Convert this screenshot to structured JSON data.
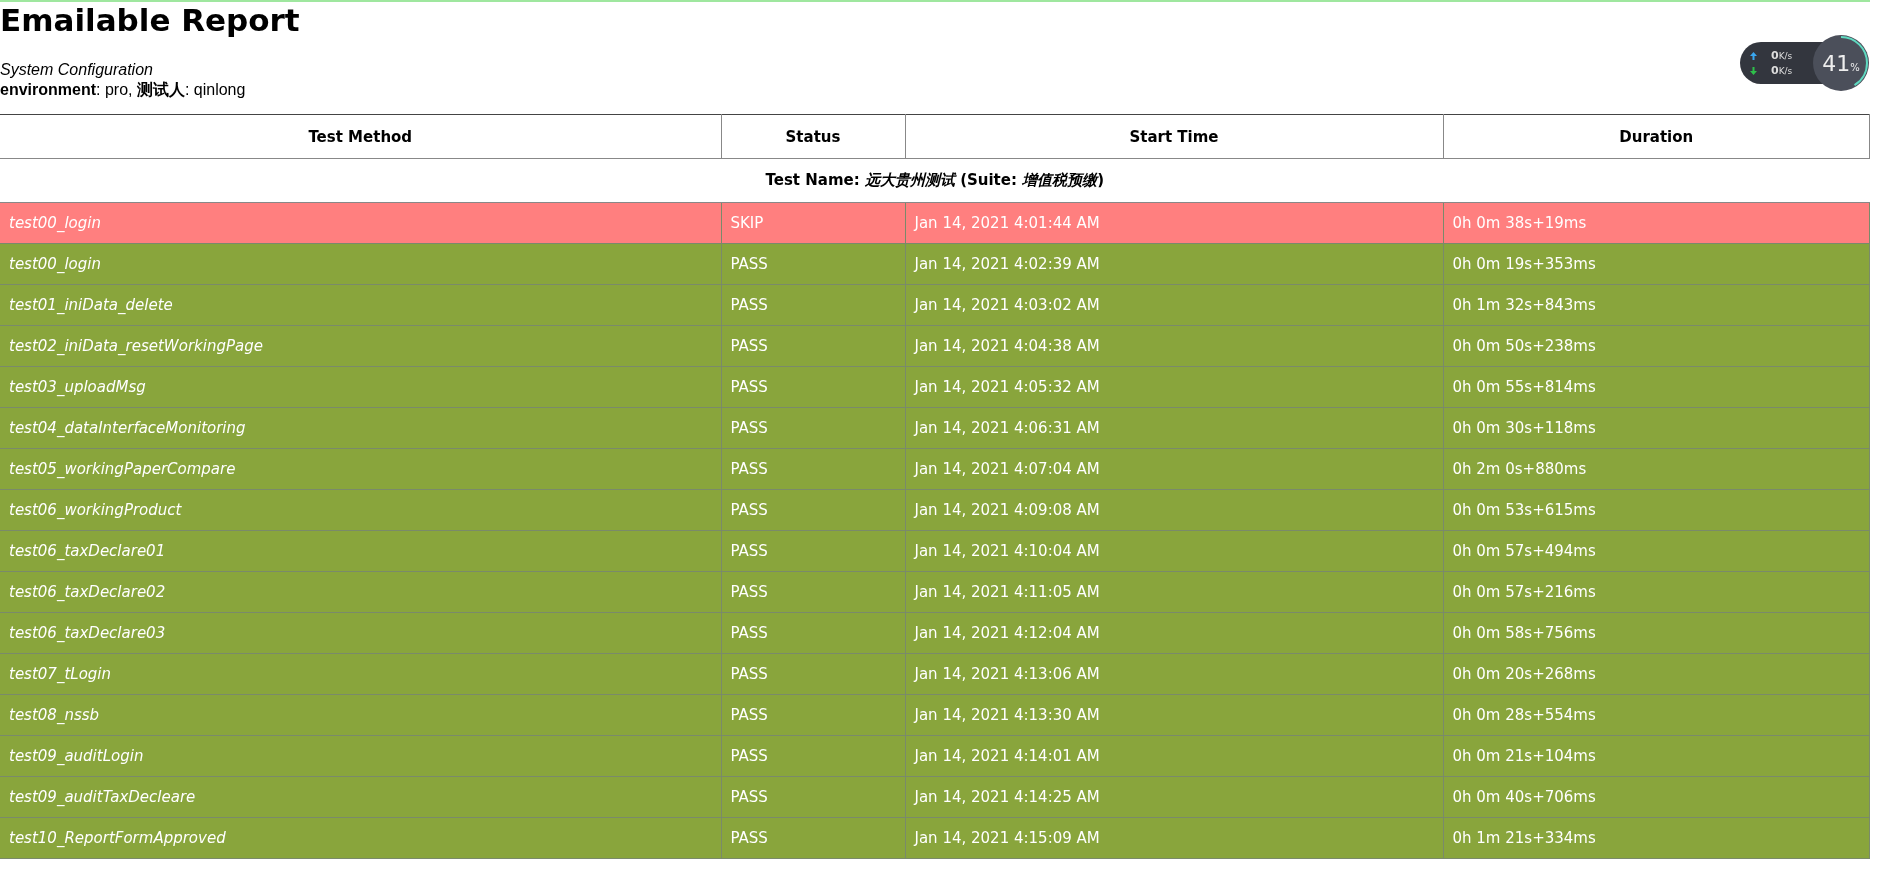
{
  "title": "Emailable Report",
  "config": {
    "heading": "System Configuration",
    "line": "**environment**: pro, **测试人**: qinlong"
  },
  "speed_widget": {
    "upload_value": "0",
    "upload_unit": "K/s",
    "download_value": "0",
    "download_unit": "K/s",
    "percent": "41",
    "percent_sign": "%",
    "level": 0.41
  },
  "table": {
    "columns": [
      "Test Method",
      "Status",
      "Start Time",
      "Duration"
    ],
    "group_title": "Test Name: *远大贵州测试* (Suite: *增值税预缴*)",
    "rows": [
      {
        "kind": "skip",
        "method": "test00_login",
        "status": "SKIP",
        "start": "Jan 14, 2021 4:01:44 AM",
        "duration": "0h 0m 38s+19ms"
      },
      {
        "kind": "pass",
        "method": "test00_login",
        "status": "PASS",
        "start": "Jan 14, 2021 4:02:39 AM",
        "duration": "0h 0m 19s+353ms"
      },
      {
        "kind": "pass",
        "method": "test01_iniData_delete",
        "status": "PASS",
        "start": "Jan 14, 2021 4:03:02 AM",
        "duration": "0h 1m 32s+843ms"
      },
      {
        "kind": "pass",
        "method": "test02_iniData_resetWorkingPage",
        "status": "PASS",
        "start": "Jan 14, 2021 4:04:38 AM",
        "duration": "0h 0m 50s+238ms"
      },
      {
        "kind": "pass",
        "method": "test03_uploadMsg",
        "status": "PASS",
        "start": "Jan 14, 2021 4:05:32 AM",
        "duration": "0h 0m 55s+814ms"
      },
      {
        "kind": "pass",
        "method": "test04_dataInterfaceMonitoring",
        "status": "PASS",
        "start": "Jan 14, 2021 4:06:31 AM",
        "duration": "0h 0m 30s+118ms"
      },
      {
        "kind": "pass",
        "method": "test05_workingPaperCompare",
        "status": "PASS",
        "start": "Jan 14, 2021 4:07:04 AM",
        "duration": "0h 2m 0s+880ms"
      },
      {
        "kind": "pass",
        "method": "test06_workingProduct",
        "status": "PASS",
        "start": "Jan 14, 2021 4:09:08 AM",
        "duration": "0h 0m 53s+615ms"
      },
      {
        "kind": "pass",
        "method": "test06_taxDeclare01",
        "status": "PASS",
        "start": "Jan 14, 2021 4:10:04 AM",
        "duration": "0h 0m 57s+494ms"
      },
      {
        "kind": "pass",
        "method": "test06_taxDeclare02",
        "status": "PASS",
        "start": "Jan 14, 2021 4:11:05 AM",
        "duration": "0h 0m 57s+216ms"
      },
      {
        "kind": "pass",
        "method": "test06_taxDeclare03",
        "status": "PASS",
        "start": "Jan 14, 2021 4:12:04 AM",
        "duration": "0h 0m 58s+756ms"
      },
      {
        "kind": "pass",
        "method": "test07_tLogin",
        "status": "PASS",
        "start": "Jan 14, 2021 4:13:06 AM",
        "duration": "0h 0m 20s+268ms"
      },
      {
        "kind": "pass",
        "method": "test08_nssb",
        "status": "PASS",
        "start": "Jan 14, 2021 4:13:30 AM",
        "duration": "0h 0m 28s+554ms"
      },
      {
        "kind": "pass",
        "method": "test09_auditLogin",
        "status": "PASS",
        "start": "Jan 14, 2021 4:14:01 AM",
        "duration": "0h 0m 21s+104ms"
      },
      {
        "kind": "pass",
        "method": "test09_auditTaxDecleare",
        "status": "PASS",
        "start": "Jan 14, 2021 4:14:25 AM",
        "duration": "0h 0m 40s+706ms"
      },
      {
        "kind": "pass",
        "method": "test10_ReportFormApproved",
        "status": "PASS",
        "start": "Jan 14, 2021 4:15:09 AM",
        "duration": "0h 1m 21s+334ms"
      }
    ]
  }
}
